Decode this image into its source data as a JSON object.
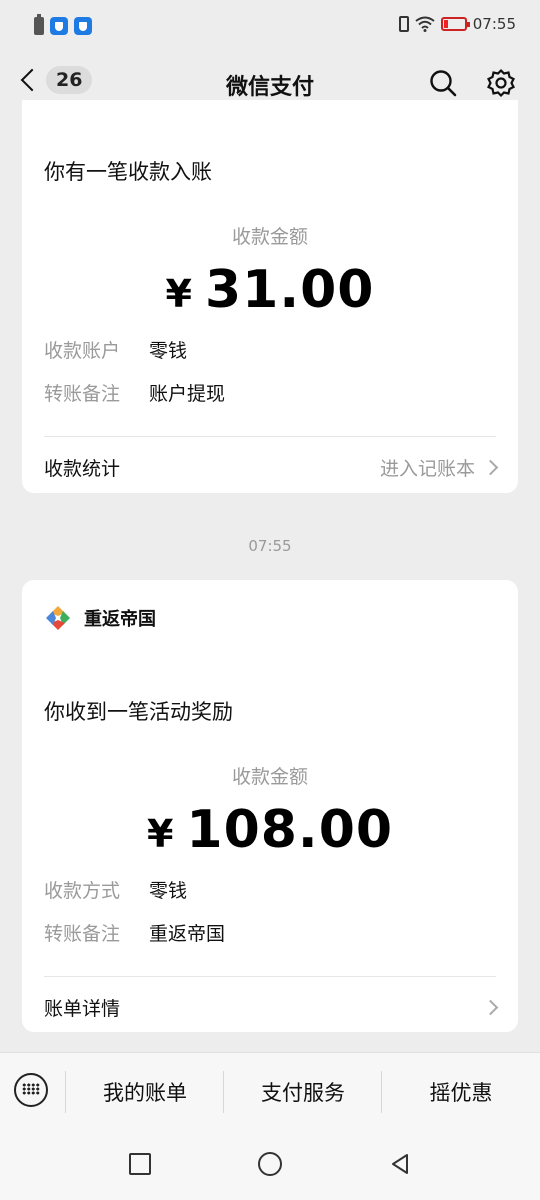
{
  "status_bar": {
    "time": "07:55"
  },
  "nav": {
    "back_count": "26",
    "title": "微信支付"
  },
  "cards": [
    {
      "heading": "你有一笔收款入账",
      "amount_label": "收款金额",
      "currency": "¥",
      "amount": "31.00",
      "rows": [
        {
          "key": "收款账户",
          "value": "零钱"
        },
        {
          "key": "转账备注",
          "value": "账户提现"
        }
      ],
      "footer_left": "收款统计",
      "footer_right": "进入记账本"
    },
    {
      "brand": "重返帝国",
      "heading": "你收到一笔活动奖励",
      "amount_label": "收款金额",
      "currency": "¥",
      "amount": "108.00",
      "rows": [
        {
          "key": "收款方式",
          "value": "零钱"
        },
        {
          "key": "转账备注",
          "value": "重返帝国"
        }
      ],
      "footer_left": "账单详情",
      "footer_right": ""
    }
  ],
  "timestamp": "07:55",
  "bottom_menu": [
    "我的账单",
    "支付服务",
    "摇优惠"
  ],
  "colors": {
    "background": "#ededed",
    "card": "#ffffff",
    "muted_text": "#9a9a9a"
  },
  "icons": [
    "battery-icon",
    "shield-icon",
    "vibrate-icon",
    "wifi-icon",
    "search-icon",
    "gear-icon",
    "keyboard-icon",
    "chevron-right-icon"
  ]
}
